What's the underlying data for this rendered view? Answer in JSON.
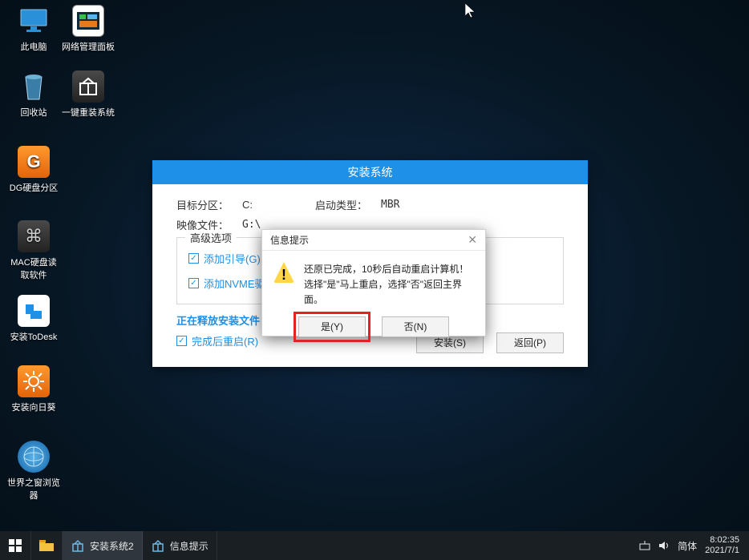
{
  "desktop_icons": {
    "this_pc": "此电脑",
    "net_panel": "网络管理面板",
    "recycle": "回收站",
    "one_key": "一键重装系统",
    "dg": "DG硬盘分区",
    "mac": "MAC硬盘读取软件",
    "todesk": "安装ToDesk",
    "sunflower": "安装向日葵",
    "browser": "世界之窗浏览器"
  },
  "installer": {
    "title": "安装系统",
    "target_label": "目标分区：",
    "target_value": "C:",
    "boot_label": "启动类型：",
    "boot_value": "MBR",
    "image_label": "映像文件：",
    "image_value": "G:\\",
    "adv_label": "高级选项",
    "chk_boot": "添加引导(G):",
    "chk_nvme": "添加NVME驱",
    "progress_label": "正在释放安装文件",
    "chk_restart": "完成后重启(R)",
    "btn_install": "安装(S)",
    "btn_back": "返回(P)"
  },
  "dialog": {
    "title": "信息提示",
    "line1": "还原已完成，10秒后自动重启计算机！",
    "line2": "选择\"是\"马上重启，选择\"否\"返回主界面。",
    "yes": "是(Y)",
    "no": "否(N)"
  },
  "taskbar": {
    "app1": "安装系统2",
    "app2": "信息提示",
    "ime": "简体",
    "time": "8:02:35",
    "date": "2021/7/1"
  }
}
